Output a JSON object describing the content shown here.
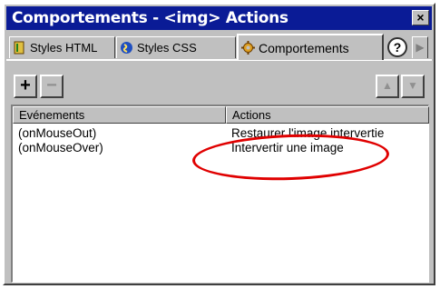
{
  "window": {
    "title": "Comportements - <img> Actions",
    "close_glyph": "×"
  },
  "tabs": [
    {
      "label": "Styles HTML",
      "icon": "styles-html-icon"
    },
    {
      "label": "Styles CSS",
      "icon": "styles-css-icon"
    },
    {
      "label": "Comportements",
      "icon": "gear-icon",
      "active": true
    }
  ],
  "help_glyph": "?",
  "toolbar": {
    "add_glyph": "+",
    "remove_glyph": "−",
    "up_glyph": "▲",
    "down_glyph": "▼"
  },
  "list": {
    "headers": [
      "Evénements",
      "Actions"
    ],
    "rows": [
      {
        "event": "(onMouseOut)",
        "action": "Restaurer l'image intervertie"
      },
      {
        "event": "(onMouseOver)",
        "action": "Intervertir une image"
      }
    ]
  },
  "colors": {
    "titlebar": "#0a1b96",
    "panel": "#c0c0c0",
    "highlight_oval": "#e00000"
  }
}
